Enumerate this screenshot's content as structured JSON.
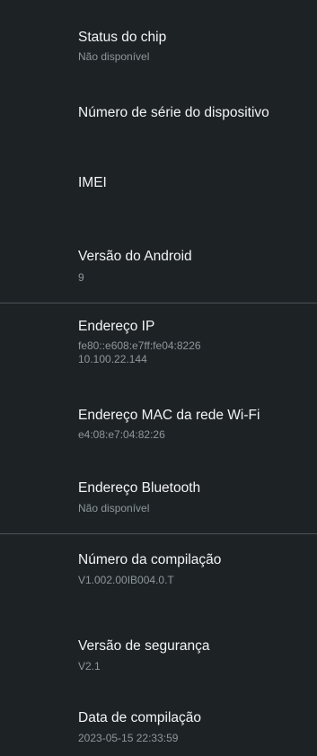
{
  "items": [
    {
      "title": "Status do chip",
      "subtitle": "Não disponível"
    },
    {
      "title": "Número de série do dispositivo"
    },
    {
      "title": "IMEI"
    },
    {
      "title": "Versão do Android",
      "subtitle": "9"
    },
    {
      "title": "Endereço IP",
      "subtitle": "fe80::e608:e7ff:fe04:8226",
      "subtitle2": "10.100.22.144"
    },
    {
      "title": "Endereço MAC da rede Wi-Fi",
      "subtitle": "e4:08:e7:04:82:26"
    },
    {
      "title": "Endereço Bluetooth",
      "subtitle": "Não disponível"
    },
    {
      "title": "Número da compilação",
      "subtitle": "V1.002.00IB004.0.T"
    },
    {
      "title": "Versão de segurança",
      "subtitle": "V2.1"
    },
    {
      "title": "Data de compilação",
      "subtitle": "2023-05-15 22:33:59"
    }
  ],
  "colors": {
    "background": "#1d2225",
    "title": "#f2f4f5",
    "subtitle": "#8e979b",
    "divider": "#4a5256"
  }
}
